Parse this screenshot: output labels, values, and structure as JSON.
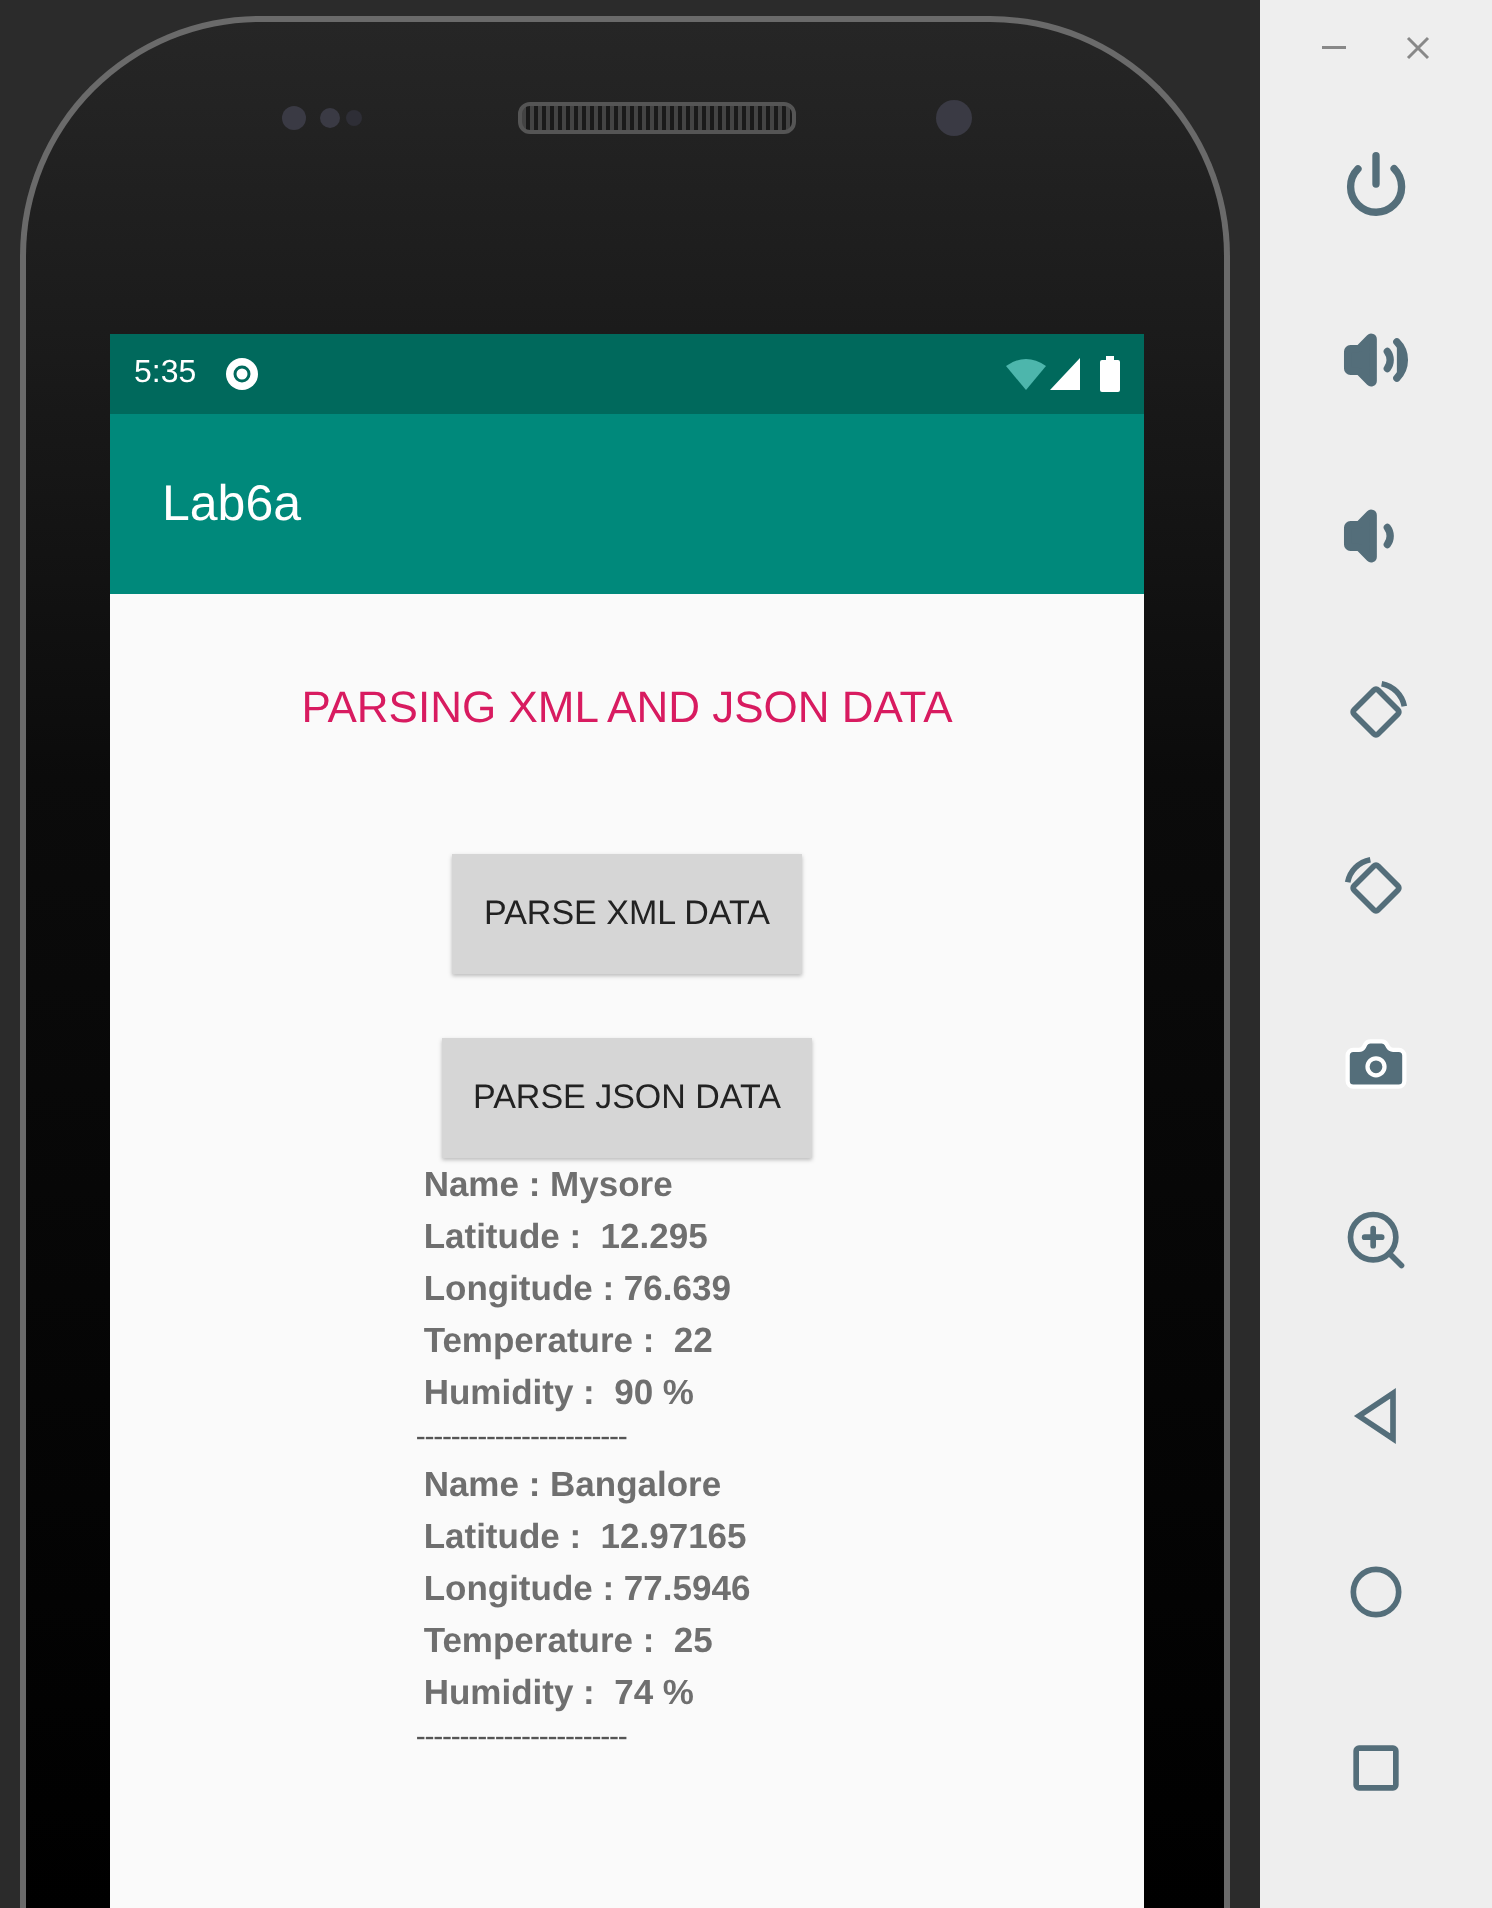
{
  "status_bar": {
    "time": "5:35"
  },
  "app_bar": {
    "title": "Lab6a"
  },
  "heading": "PARSING XML AND JSON DATA",
  "buttons": [
    "PARSE XML DATA",
    "PARSE JSON DATA"
  ],
  "results": [
    {
      "lines": [
        "Name : Mysore",
        "Latitude :  12.295",
        "Longitude : 76.639",
        "Temperature :  22",
        "Humidity :  90 %"
      ],
      "separator": "------------------------"
    },
    {
      "lines": [
        "Name : Bangalore",
        "Latitude :  12.97165",
        "Longitude : 77.5946",
        "Temperature :  25",
        "Humidity :  74 %"
      ],
      "separator": "------------------------"
    }
  ],
  "emulator_toolbar": {
    "buttons": [
      {
        "kind": "power"
      },
      {
        "kind": "volume-up"
      },
      {
        "kind": "volume-down"
      },
      {
        "kind": "rotate-left"
      },
      {
        "kind": "rotate-right"
      },
      {
        "kind": "screenshot"
      },
      {
        "kind": "zoom"
      },
      {
        "kind": "back"
      },
      {
        "kind": "home"
      },
      {
        "kind": "overview"
      }
    ]
  }
}
